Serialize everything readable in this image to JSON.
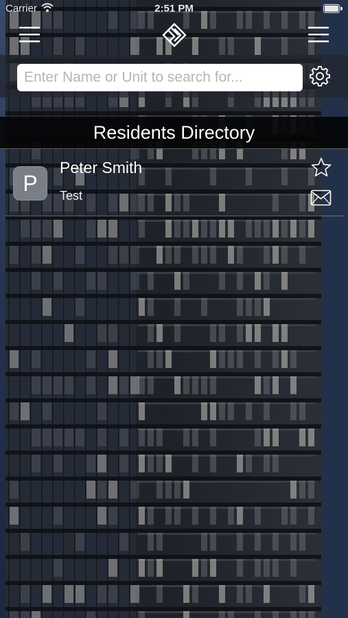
{
  "status_bar": {
    "carrier": "Carrier",
    "time": "2:51 PM"
  },
  "nav": {
    "left_icon": "hamburger-menu-icon",
    "center_icon": "building-logo-icon",
    "right_icon": "menu-icon"
  },
  "search": {
    "placeholder": "Enter Name or Unit to search for...",
    "value": "",
    "settings_icon": "gear-icon"
  },
  "directory": {
    "title": "Residents Directory",
    "residents": [
      {
        "initial": "P",
        "name": "Peter Smith",
        "subtitle": "Test",
        "favorite_icon": "star-icon",
        "message_icon": "mail-icon"
      }
    ]
  },
  "colors": {
    "search_band": "#23262d",
    "title_band": "#050508",
    "avatar_bg": "#7a7e86"
  }
}
